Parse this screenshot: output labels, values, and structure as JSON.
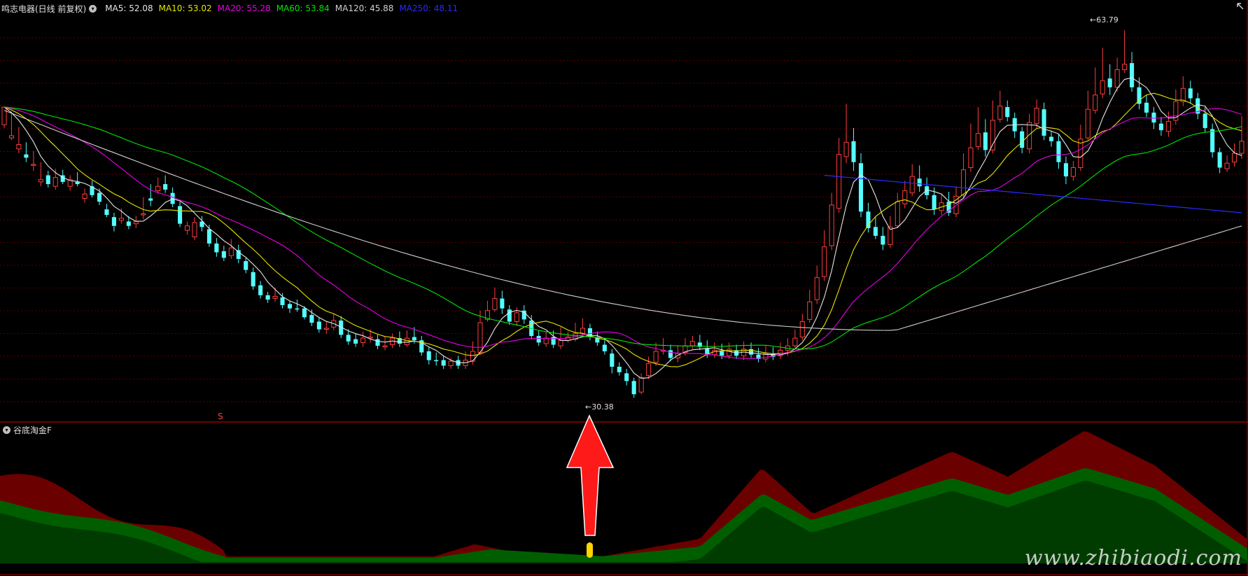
{
  "header": {
    "stock_name": "鸣志电器(日线 前复权)",
    "ma_items": [
      {
        "label": "MA5: 52.08",
        "color": "#e6e6e6"
      },
      {
        "label": "MA10: 53.02",
        "color": "#e6e600"
      },
      {
        "label": "MA20: 55.28",
        "color": "#e600e6"
      },
      {
        "label": "MA60: 53.84",
        "color": "#00e600"
      },
      {
        "label": "MA120: 45.88",
        "color": "#cfcfcf"
      },
      {
        "label": "MA250: 48.11",
        "color": "#2a2aff"
      }
    ]
  },
  "price_labels": {
    "high": "63.79",
    "low": "30.38",
    "marker": "S"
  },
  "indicator": {
    "name": "谷底淘金F"
  },
  "watermark": "www.zhibiaodi.com",
  "colors": {
    "up": "#ff3d3d",
    "down": "#54ffff",
    "grid": "#5a0000",
    "area_red": "#6b0000",
    "area_green": "#005e00",
    "area_green_dark": "#003c00",
    "arrow": "#ff1a1a",
    "signal": "#ffd400"
  },
  "chart_data": {
    "type": "candlestick",
    "price_range": [
      29.0,
      64.5
    ],
    "extremes": {
      "high": 63.79,
      "low": 30.38
    },
    "ma_series": [
      {
        "name": "MA5",
        "last": 52.08
      },
      {
        "name": "MA10",
        "last": 53.02
      },
      {
        "name": "MA20",
        "last": 55.28
      },
      {
        "name": "MA60",
        "last": 53.84
      },
      {
        "name": "MA120",
        "last": 45.88
      },
      {
        "name": "MA250",
        "last": 48.11
      }
    ],
    "candles": [
      [
        55.2,
        56.8,
        55.9,
        54.9
      ],
      [
        54.0,
        54.2,
        56.4,
        53.8
      ],
      [
        53.0,
        53.4,
        55.0,
        52.6
      ],
      [
        52.5,
        52.2,
        53.6,
        51.8
      ],
      [
        51.5,
        51.6,
        52.8,
        51.0
      ],
      [
        50.0,
        50.2,
        51.8,
        49.6
      ],
      [
        50.6,
        49.8,
        51.0,
        49.5
      ],
      [
        49.6,
        50.4,
        51.2,
        49.3
      ],
      [
        50.6,
        50.0,
        51.1,
        49.8
      ],
      [
        49.6,
        50.2,
        50.6,
        49.2
      ],
      [
        50.0,
        49.8,
        50.9,
        49.6
      ],
      [
        48.5,
        48.9,
        49.4,
        48.1
      ],
      [
        49.6,
        48.8,
        50.1,
        48.6
      ],
      [
        49.0,
        48.2,
        49.4,
        47.9
      ],
      [
        47.5,
        47.0,
        48.0,
        46.8
      ],
      [
        46.8,
        46.0,
        47.2,
        45.5
      ],
      [
        46.5,
        46.7,
        47.6,
        46.2
      ],
      [
        46.4,
        46.0,
        46.9,
        45.7
      ],
      [
        46.2,
        46.4,
        46.9,
        45.8
      ],
      [
        47.0,
        47.1,
        48.6,
        46.6
      ],
      [
        48.5,
        48.3,
        49.8,
        47.8
      ],
      [
        49.2,
        49.6,
        50.4,
        48.9
      ],
      [
        49.8,
        49.3,
        50.6,
        49.0
      ],
      [
        49.0,
        48.0,
        49.5,
        47.7
      ],
      [
        47.8,
        46.2,
        48.2,
        45.9
      ],
      [
        45.6,
        46.0,
        46.4,
        45.2
      ],
      [
        45.0,
        46.3,
        46.8,
        44.7
      ],
      [
        46.4,
        45.9,
        46.9,
        45.5
      ],
      [
        45.7,
        44.4,
        46.1,
        44.1
      ],
      [
        44.4,
        43.6,
        44.9,
        43.2
      ],
      [
        43.7,
        43.1,
        44.2,
        42.8
      ],
      [
        43.3,
        44.0,
        44.8,
        43.0
      ],
      [
        43.8,
        43.0,
        44.3,
        42.6
      ],
      [
        42.8,
        42.0,
        43.1,
        41.7
      ],
      [
        41.8,
        40.5,
        42.2,
        40.2
      ],
      [
        40.6,
        39.7,
        41.0,
        39.4
      ],
      [
        39.7,
        39.3,
        40.0,
        39.0
      ],
      [
        39.4,
        39.6,
        40.4,
        39.1
      ],
      [
        39.5,
        38.8,
        39.9,
        38.5
      ],
      [
        38.9,
        38.5,
        39.2,
        38.1
      ],
      [
        38.5,
        38.4,
        39.3,
        38.2
      ],
      [
        38.5,
        37.7,
        38.7,
        37.5
      ],
      [
        37.9,
        37.2,
        38.4,
        36.9
      ],
      [
        37.3,
        36.6,
        37.7,
        36.3
      ],
      [
        36.6,
        36.7,
        37.3,
        36.2
      ],
      [
        36.8,
        37.4,
        38.0,
        36.5
      ],
      [
        37.4,
        36.1,
        37.8,
        35.8
      ],
      [
        36.1,
        35.5,
        36.6,
        35.2
      ],
      [
        35.7,
        35.3,
        36.2,
        35.0
      ],
      [
        35.4,
        35.8,
        36.4,
        35.0
      ],
      [
        35.9,
        35.9,
        36.6,
        35.4
      ],
      [
        35.7,
        35.1,
        36.1,
        34.8
      ],
      [
        35.0,
        35.1,
        35.9,
        34.7
      ],
      [
        35.2,
        35.8,
        36.2,
        34.9
      ],
      [
        35.8,
        35.3,
        36.4,
        35.0
      ],
      [
        35.2,
        35.8,
        36.5,
        35.0
      ],
      [
        35.9,
        35.6,
        36.8,
        35.3
      ],
      [
        35.6,
        34.5,
        36.0,
        34.2
      ],
      [
        34.6,
        33.8,
        35.0,
        33.4
      ],
      [
        33.8,
        33.7,
        34.5,
        33.3
      ],
      [
        33.8,
        33.3,
        34.2,
        33.0
      ],
      [
        33.3,
        33.7,
        34.0,
        33.0
      ],
      [
        33.8,
        33.3,
        34.2,
        33.0
      ],
      [
        33.3,
        33.8,
        34.6,
        33.0
      ],
      [
        33.7,
        34.6,
        35.5,
        33.4
      ],
      [
        34.5,
        37.2,
        38.3,
        34.3
      ],
      [
        37.5,
        38.3,
        39.2,
        37.3
      ],
      [
        38.4,
        39.4,
        40.4,
        38.2
      ],
      [
        39.4,
        38.5,
        40.1,
        38.0
      ],
      [
        38.4,
        37.3,
        38.8,
        37.0
      ],
      [
        37.3,
        38.1,
        38.6,
        36.9
      ],
      [
        38.3,
        37.5,
        38.8,
        37.1
      ],
      [
        37.4,
        36.0,
        37.9,
        35.7
      ],
      [
        36.0,
        35.4,
        36.5,
        35.1
      ],
      [
        35.3,
        35.8,
        36.4,
        35.0
      ],
      [
        35.9,
        35.2,
        36.5,
        34.9
      ],
      [
        35.1,
        35.6,
        36.8,
        34.8
      ],
      [
        35.6,
        35.9,
        36.4,
        35.4
      ],
      [
        35.7,
        36.2,
        37.2,
        35.5
      ],
      [
        36.2,
        36.7,
        37.6,
        35.9
      ],
      [
        36.7,
        35.9,
        37.1,
        35.6
      ],
      [
        35.9,
        35.4,
        36.4,
        35.1
      ],
      [
        35.2,
        34.6,
        35.6,
        34.3
      ],
      [
        34.4,
        33.2,
        34.8,
        32.6
      ],
      [
        33.2,
        32.7,
        33.6,
        32.4
      ],
      [
        32.6,
        31.9,
        33.0,
        31.5
      ],
      [
        31.9,
        30.7,
        32.2,
        30.38
      ],
      [
        30.9,
        32.2,
        32.6,
        30.7
      ],
      [
        32.4,
        33.5,
        34.1,
        32.1
      ],
      [
        33.6,
        34.6,
        35.4,
        33.3
      ],
      [
        34.6,
        34.7,
        35.8,
        34.3
      ],
      [
        34.7,
        34.0,
        35.2,
        33.7
      ],
      [
        34.0,
        34.4,
        35.1,
        33.6
      ],
      [
        34.5,
        35.1,
        35.8,
        34.2
      ],
      [
        35.1,
        35.5,
        36.0,
        34.8
      ],
      [
        35.4,
        35.0,
        36.1,
        34.7
      ],
      [
        34.9,
        34.3,
        35.6,
        34.0
      ],
      [
        34.3,
        34.7,
        35.4,
        34.0
      ],
      [
        34.6,
        34.2,
        35.3,
        33.9
      ],
      [
        34.2,
        34.8,
        35.4,
        33.9
      ],
      [
        34.7,
        34.2,
        35.2,
        33.9
      ],
      [
        34.2,
        34.8,
        35.5,
        33.8
      ],
      [
        34.8,
        34.3,
        35.4,
        34.0
      ],
      [
        34.3,
        33.9,
        34.9,
        33.6
      ],
      [
        33.9,
        34.4,
        35.1,
        33.6
      ],
      [
        34.4,
        34.1,
        35.0,
        33.8
      ],
      [
        34.2,
        34.7,
        35.4,
        33.9
      ],
      [
        34.7,
        35.1,
        35.8,
        34.2
      ],
      [
        35.1,
        35.8,
        36.6,
        34.9
      ],
      [
        35.9,
        37.3,
        38.0,
        35.6
      ],
      [
        37.5,
        39.1,
        40.2,
        37.2
      ],
      [
        39.3,
        41.3,
        42.4,
        38.9
      ],
      [
        41.4,
        44.1,
        45.6,
        41.0
      ],
      [
        44.2,
        47.9,
        49.0,
        43.8
      ],
      [
        47.6,
        52.5,
        54.0,
        47.2
      ],
      [
        52.3,
        53.6,
        57.1,
        51.7
      ],
      [
        53.7,
        51.8,
        54.9,
        51.0
      ],
      [
        51.7,
        47.3,
        52.6,
        46.8
      ],
      [
        47.3,
        45.8,
        48.1,
        45.4
      ],
      [
        45.9,
        45.1,
        46.8,
        44.8
      ],
      [
        45.1,
        44.3,
        45.9,
        43.8
      ],
      [
        44.3,
        45.9,
        46.9,
        44.0
      ],
      [
        46.0,
        48.2,
        49.0,
        45.8
      ],
      [
        48.0,
        49.2,
        50.1,
        47.6
      ],
      [
        49.0,
        50.5,
        51.6,
        48.7
      ],
      [
        50.3,
        49.6,
        51.5,
        49.1
      ],
      [
        49.6,
        48.8,
        50.4,
        48.4
      ],
      [
        48.8,
        47.5,
        49.5,
        47.0
      ],
      [
        47.4,
        48.1,
        48.9,
        47.0
      ],
      [
        48.2,
        47.2,
        49.1,
        46.9
      ],
      [
        47.1,
        48.7,
        49.6,
        46.8
      ],
      [
        48.8,
        51.1,
        52.6,
        48.5
      ],
      [
        51.3,
        53.1,
        55.3,
        50.9
      ],
      [
        53.2,
        54.4,
        56.8,
        52.9
      ],
      [
        54.5,
        52.9,
        55.7,
        52.3
      ],
      [
        52.9,
        55.6,
        57.4,
        52.6
      ],
      [
        55.7,
        56.9,
        58.3,
        55.4
      ],
      [
        56.8,
        55.9,
        57.4,
        55.5
      ],
      [
        55.8,
        54.6,
        56.3,
        54.0
      ],
      [
        54.6,
        53.1,
        55.0,
        52.6
      ],
      [
        53.0,
        55.4,
        56.2,
        52.6
      ],
      [
        55.3,
        56.7,
        57.5,
        54.9
      ],
      [
        56.6,
        54.2,
        57.2,
        53.8
      ],
      [
        54.1,
        53.7,
        54.6,
        53.2
      ],
      [
        53.7,
        51.8,
        54.4,
        51.2
      ],
      [
        51.7,
        50.5,
        52.3,
        49.8
      ],
      [
        50.5,
        51.3,
        51.9,
        50.1
      ],
      [
        51.3,
        53.9,
        55.2,
        51.0
      ],
      [
        54.0,
        56.6,
        58.3,
        53.8
      ],
      [
        56.5,
        57.9,
        60.4,
        56.2
      ],
      [
        58.0,
        59.2,
        62.2,
        57.6
      ],
      [
        59.4,
        58.6,
        60.7,
        57.9
      ],
      [
        58.6,
        60.2,
        61.3,
        58.2
      ],
      [
        60.2,
        60.7,
        63.79,
        59.9
      ],
      [
        60.8,
        58.6,
        61.8,
        58.2
      ],
      [
        58.6,
        57.1,
        59.5,
        56.6
      ],
      [
        57.2,
        56.3,
        57.9,
        55.9
      ],
      [
        56.3,
        55.4,
        56.8,
        54.8
      ],
      [
        55.3,
        54.7,
        55.9,
        54.2
      ],
      [
        54.6,
        55.5,
        56.4,
        54.1
      ],
      [
        55.6,
        57.3,
        58.4,
        55.2
      ],
      [
        57.3,
        58.5,
        59.6,
        56.9
      ],
      [
        58.5,
        57.6,
        59.2,
        57.1
      ],
      [
        57.6,
        56.2,
        58.1,
        55.7
      ],
      [
        56.2,
        54.9,
        56.8,
        54.5
      ],
      [
        54.8,
        52.7,
        55.3,
        52.2
      ],
      [
        52.7,
        51.3,
        53.1,
        50.8
      ],
      [
        51.2,
        51.7,
        52.4,
        50.9
      ],
      [
        51.8,
        52.6,
        53.5,
        51.4
      ],
      [
        52.6,
        53.7,
        56.0,
        52.1
      ]
    ]
  }
}
